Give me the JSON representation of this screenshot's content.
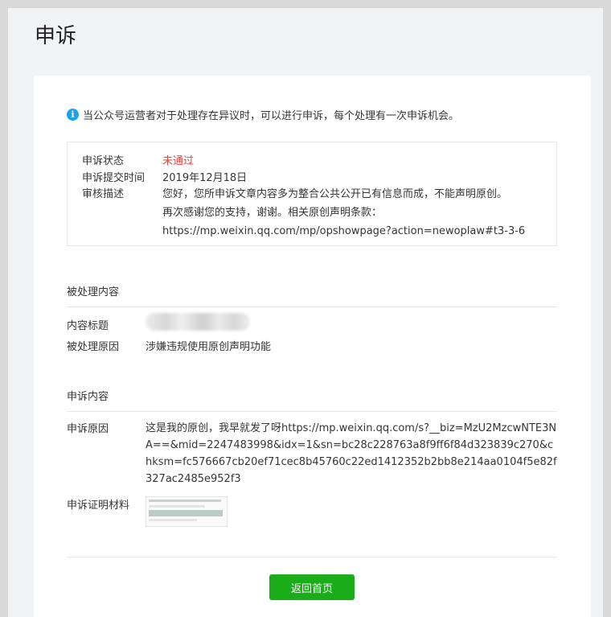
{
  "page": {
    "title": "申诉"
  },
  "notice": {
    "text": "当公众号运营者对于处理存在异议时，可以进行申诉，每个处理有一次申诉机会。"
  },
  "status": {
    "state_label": "申诉状态",
    "state_value": "未通过",
    "time_label": "申诉提交时间",
    "time_value": "2019年12月18日",
    "desc_label": "审核描述",
    "desc_lines": [
      "您好，您所申诉文章内容多为整合公共公开已有信息而成，不能声明原创。",
      "再次感谢您的支持，谢谢。相关原创声明条款：",
      "https://mp.weixin.qq.com/mp/opshowpage?action=newoplaw#t3-3-6"
    ]
  },
  "processed": {
    "section_title": "被处理内容",
    "title_label": "内容标题",
    "reason_label": "被处理原因",
    "reason_value": "涉嫌违规使用原创声明功能"
  },
  "appeal": {
    "section_title": "申诉内容",
    "reason_label": "申诉原因",
    "reason_value": "这是我的原创，我早就发了呀https://mp.weixin.qq.com/s?__biz=MzU2MzcwNTE3NA==&mid=2247483998&idx=1&sn=bc28c228763a8f9ff6f84d323839c270&chksm=fc576667cb20ef71cec8b45760c22ed1412352b2bb8e214aa0104f5e82f327ac2485e952f3",
    "evidence_label": "申诉证明材料"
  },
  "actions": {
    "back_label": "返回首页"
  },
  "colors": {
    "accent": "#1aad19",
    "error": "#e64340",
    "info": "#1aa3e8"
  }
}
